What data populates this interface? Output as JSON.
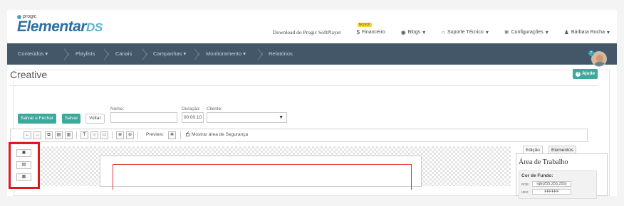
{
  "header": {
    "logo_small": "progic",
    "logo_main": "Elementar",
    "logo_suffix": "DS",
    "download_label": "Download do Progic SoftPlayer",
    "financeiro_badge": "NOVO!",
    "financeiro_label": "Financeiro",
    "blogs_label": "Blogs",
    "suporte_label": "Suporte Técnico",
    "config_label": "Configurações",
    "user_label": "Bárbara Rocha"
  },
  "navbar": {
    "items": [
      "Conteúdos",
      "Playlists",
      "Canais",
      "Campanhas",
      "Monitoramento",
      "Relatórios"
    ]
  },
  "notification_count": "7",
  "page": {
    "title": "Creative",
    "help_label": "Ajude"
  },
  "form": {
    "save_close_label": "Salvar e Fechar",
    "save_label": "Salvar",
    "back_label": "Voltar",
    "name_label": "Nome:",
    "name_value": "",
    "duration_label": "Duração:",
    "duration_value": "00:00:10",
    "client_label": "Cliente:",
    "client_value": ""
  },
  "toolbar": {
    "preview_label": "Preview:",
    "safety_label": "Mostrar área de Segurança",
    "safety_checked": true
  },
  "side_tools": [
    "image",
    "file",
    "grid"
  ],
  "panel": {
    "tab_edicao": "Edição",
    "tab_elementos": "Elementos",
    "title": "Área de Trabalho",
    "bg_header": "Cor de Fundo:",
    "rgb_label": "RGB:",
    "rgb_value": "rgb(255,255,255)",
    "hex_label": "HEX:",
    "hex_value": "FFFFFF"
  },
  "colors": {
    "navbar": "#435768",
    "accent": "#3ba99c",
    "highlight": "#e0191b"
  }
}
